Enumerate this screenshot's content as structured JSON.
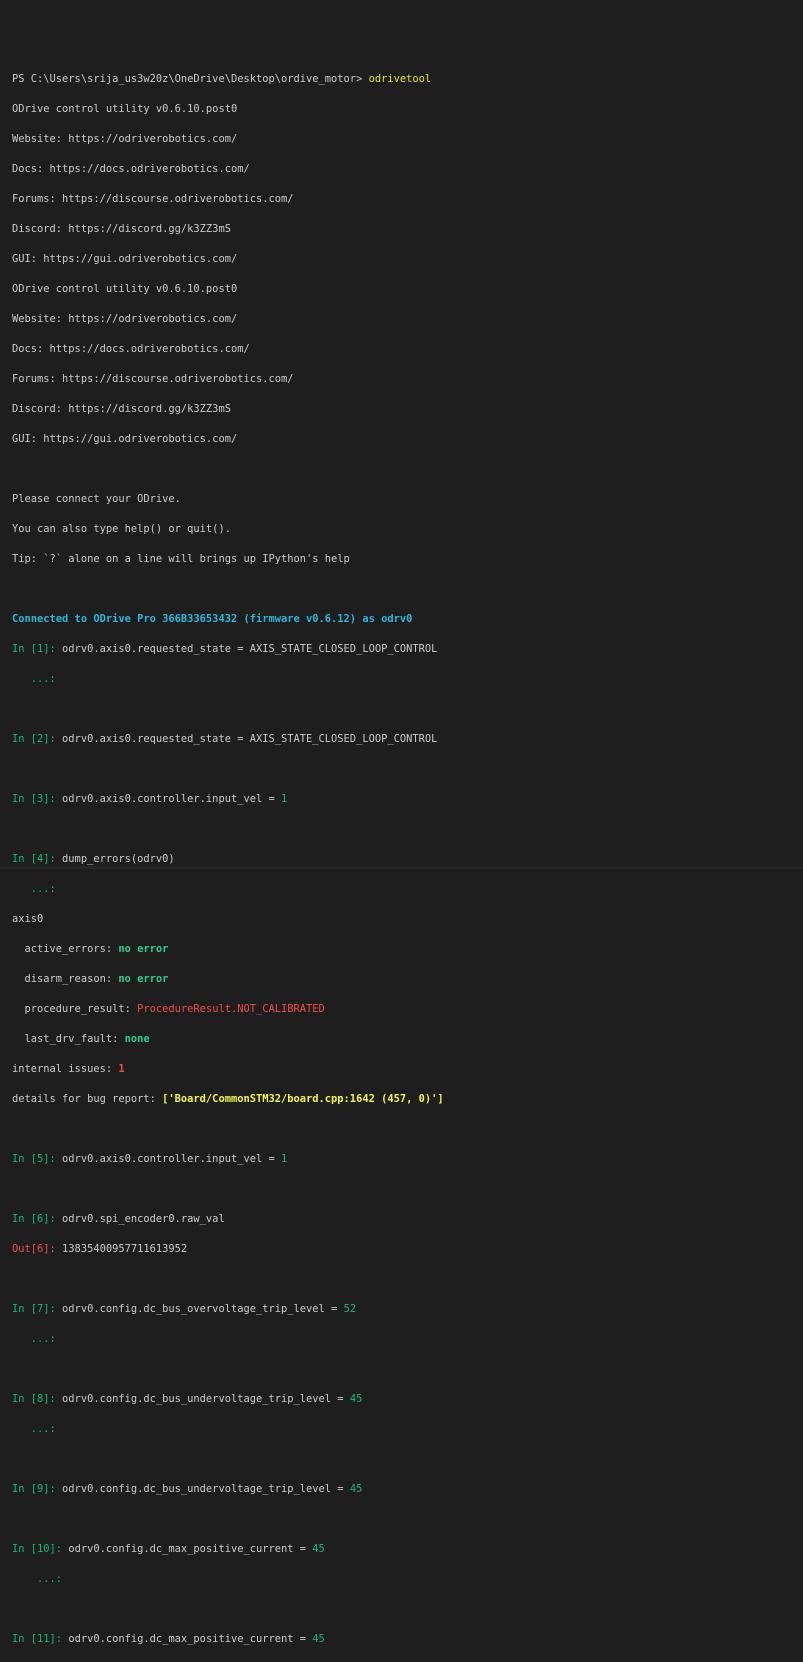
{
  "prompt": {
    "path": "PS C:\\Users\\srija_us3w20z\\OneDrive\\Desktop\\ordive_motor> ",
    "command": "odrivetool"
  },
  "banner": [
    "ODrive control utility v0.6.10.post0",
    "Website: https://odriverobotics.com/",
    "Docs: https://docs.odriverobotics.com/",
    "Forums: https://discourse.odriverobotics.com/",
    "Discord: https://discord.gg/k3ZZ3mS",
    "GUI: https://gui.odriverobotics.com/",
    "ODrive control utility v0.6.10.post0",
    "Website: https://odriverobotics.com/",
    "Docs: https://docs.odriverobotics.com/",
    "Forums: https://discourse.odriverobotics.com/",
    "Discord: https://discord.gg/k3ZZ3mS",
    "GUI: https://gui.odriverobotics.com/"
  ],
  "help": [
    "Please connect your ODrive.",
    "You can also type help() or quit().",
    "Tip: `?` alone on a line will brings up IPython's help"
  ],
  "connected": "Connected to ODrive Pro 366B33653432 (firmware v0.6.12) as odrv0",
  "cont": "   ...:",
  "cont_wide": "    ...:",
  "in1": {
    "prompt": "In [1]: ",
    "code": "odrv0.axis0.requested_state = AXIS_STATE_CLOSED_LOOP_CONTROL"
  },
  "in2": {
    "prompt": "In [2]: ",
    "code": "odrv0.axis0.requested_state = AXIS_STATE_CLOSED_LOOP_CONTROL"
  },
  "in3": {
    "prompt": "In [3]: ",
    "code": "odrv0.axis0.controller.input_vel = ",
    "num": "1"
  },
  "in4": {
    "prompt": "In [4]: ",
    "code": "dump_errors(odrv0)"
  },
  "errors": {
    "axis": "axis0",
    "active_label": "  active_errors: ",
    "active_value": "no error",
    "disarm_label": "  disarm_reason: ",
    "disarm_value": "no error",
    "proc_label": "  procedure_result: ",
    "proc_value": "ProcedureResult.NOT_CALIBRATED",
    "drv_label": "  last_drv_fault: ",
    "drv_value": "none",
    "internal_label": "internal issues: ",
    "internal_value": "1",
    "details_label": "details for bug report: ",
    "details_value": "['Board/CommonSTM32/board.cpp:1642 (457, 0)']"
  },
  "in5": {
    "prompt": "In [5]: ",
    "code": "odrv0.axis0.controller.input_vel = ",
    "num": "1"
  },
  "in6": {
    "prompt": "In [6]: ",
    "code": "odrv0.spi_encoder0.raw_val"
  },
  "out6": {
    "prompt": "Out[6]: ",
    "value": "13835400957711613952"
  },
  "in7": {
    "prompt": "In [7]: ",
    "code": "odrv0.config.dc_bus_overvoltage_trip_level = ",
    "num": "52"
  },
  "in8": {
    "prompt": "In [8]: ",
    "code": "odrv0.config.dc_bus_undervoltage_trip_level = ",
    "num": "45"
  },
  "in9": {
    "prompt": "In [9]: ",
    "code": "odrv0.config.dc_bus_undervoltage_trip_level = ",
    "num": "45"
  },
  "in10": {
    "prompt": "In [10]: ",
    "code": "odrv0.config.dc_max_positive_current = ",
    "num": "45"
  },
  "in11": {
    "prompt": "In [11]: ",
    "code": "odrv0.config.dc_max_positive_current = ",
    "num": "45"
  },
  "colors": {
    "background": "#1e1e1e",
    "foreground": "#cccccc",
    "command": "#e5e510",
    "connected": "#29b8db",
    "prompt_in": "#0dbc79",
    "prompt_out": "#f14c4c",
    "ok": "#23d18b",
    "error": "#f14c4c",
    "bug": "#f5f543"
  }
}
